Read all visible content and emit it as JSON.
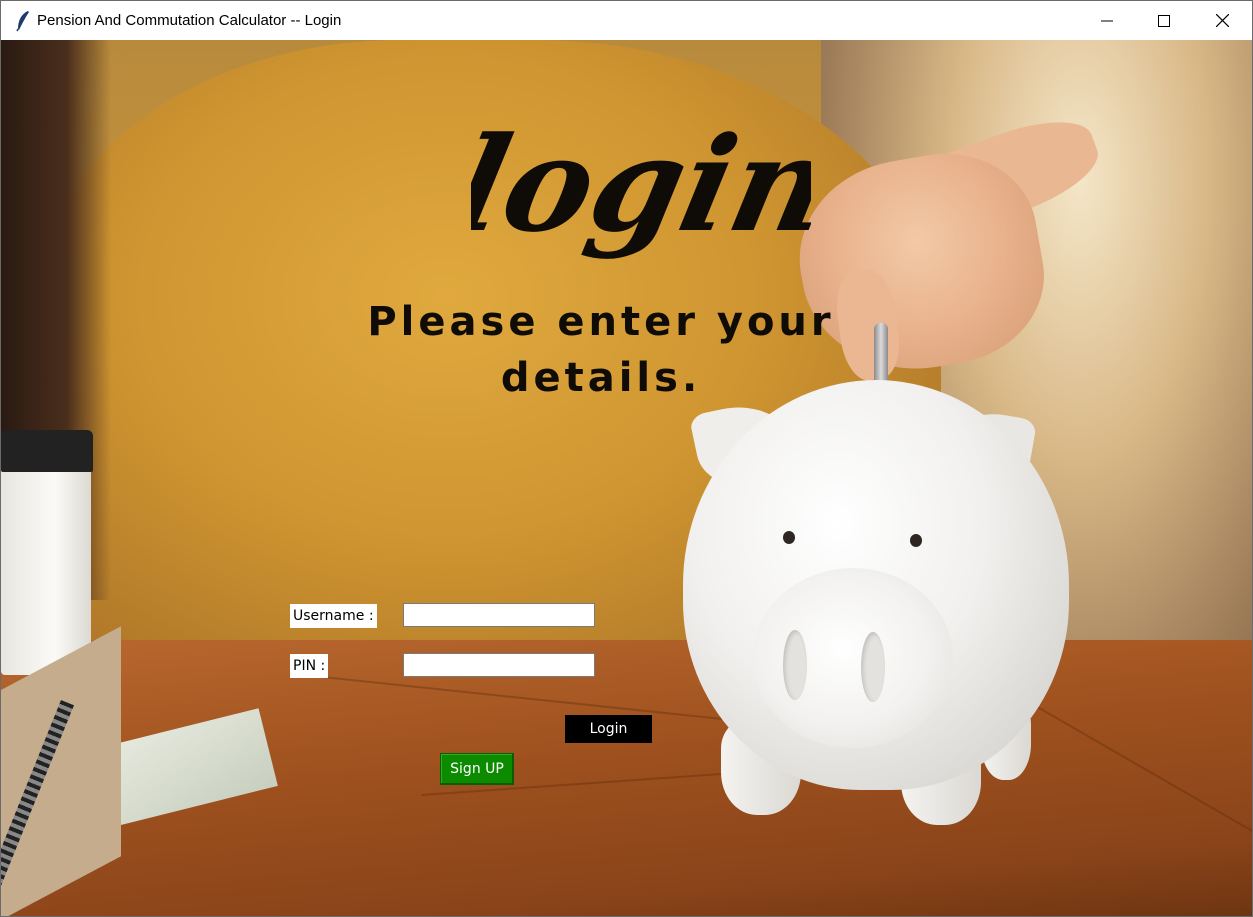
{
  "window": {
    "title": "Pension And Commutation Calculator -- Login",
    "icon": "feather-icon",
    "controls": [
      "minimize-icon",
      "maximize-icon",
      "close-icon"
    ]
  },
  "login": {
    "heading": "login",
    "subheading": "Please enter your details.",
    "username_label": "Username :",
    "username_value": "",
    "pin_label": "PIN :",
    "pin_value": "",
    "login_button": "Login",
    "signup_button": "Sign UP"
  },
  "colors": {
    "login_button_bg": "#000000",
    "signup_button_bg": "#0c8a00",
    "heading_color": "#0f0c08"
  }
}
